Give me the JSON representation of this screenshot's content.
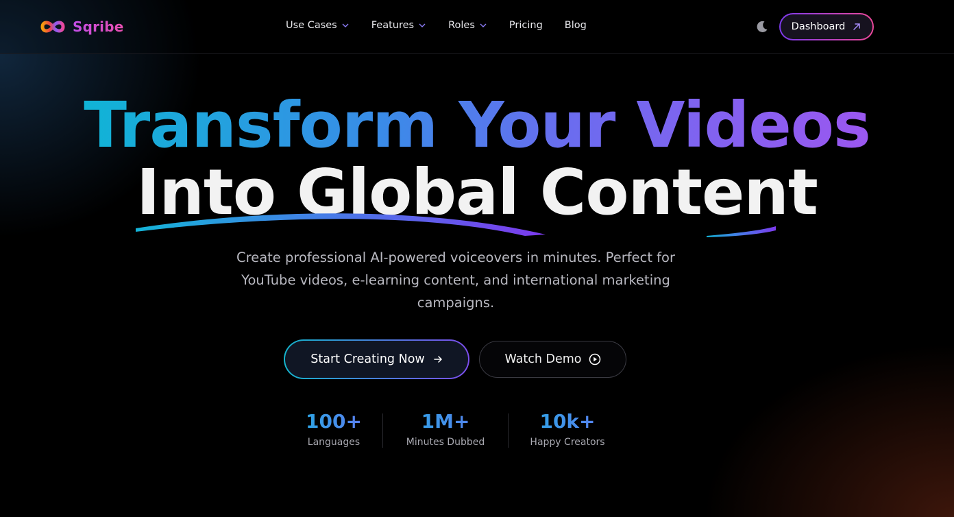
{
  "brand": {
    "name": "Sqribe",
    "logo_icon": "infinity-logo-icon"
  },
  "nav": {
    "items": [
      {
        "label": "Use Cases",
        "has_dropdown": true
      },
      {
        "label": "Features",
        "has_dropdown": true
      },
      {
        "label": "Roles",
        "has_dropdown": true
      },
      {
        "label": "Pricing",
        "has_dropdown": false
      },
      {
        "label": "Blog",
        "has_dropdown": false
      }
    ],
    "theme_icon": "moon-icon",
    "dashboard_label": "Dashboard"
  },
  "hero": {
    "line1": "Transform Your Videos",
    "line2": "Into Global Content",
    "subtitle": "Create professional AI-powered voiceovers in minutes. Perfect for YouTube videos, e-learning content, and international marketing campaigns.",
    "primary_cta": "Start Creating Now",
    "secondary_cta": "Watch Demo"
  },
  "stats": [
    {
      "value": "100+",
      "label": "Languages"
    },
    {
      "value": "1M+",
      "label": "Minutes Dubbed"
    },
    {
      "value": "10k+",
      "label": "Happy Creators"
    }
  ],
  "colors": {
    "background": "#000000",
    "accent_cyan": "#10b4d6",
    "accent_purple": "#9b57f0",
    "accent_pink": "#ec4899"
  }
}
